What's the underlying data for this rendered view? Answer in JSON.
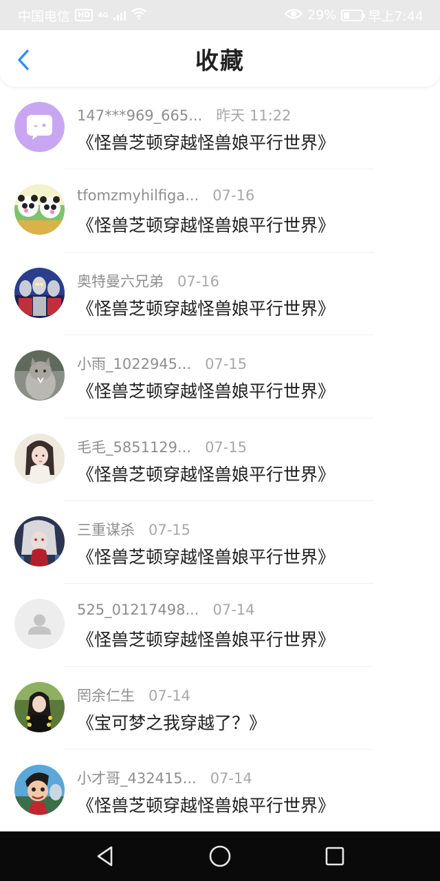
{
  "status_bar": {
    "carrier": "中国电信",
    "hd": "HD",
    "network": "4G",
    "battery": "29%",
    "time": "早上7:44"
  },
  "header": {
    "title": "收藏",
    "back_icon": "chevron-left-icon"
  },
  "favorites": [
    {
      "name": "147***969_665...",
      "time": "昨天 11:22",
      "book": "《怪兽芝顿穿越怪兽娘平行世界》",
      "avatar": "chat-bubble-avatar"
    },
    {
      "name": "tfomzmyhilfiga...",
      "time": "07-16",
      "book": "《怪兽芝顿穿越怪兽娘平行世界》",
      "avatar": "panda-avatar"
    },
    {
      "name": "奥特曼六兄弟",
      "time": "07-16",
      "book": "《怪兽芝顿穿越怪兽娘平行世界》",
      "avatar": "ultraman-avatar"
    },
    {
      "name": "小雨_1022945...",
      "time": "07-15",
      "book": "《怪兽芝顿穿越怪兽娘平行世界》",
      "avatar": "cat-avatar"
    },
    {
      "name": "毛毛_5851129...",
      "time": "07-15",
      "book": "《怪兽芝顿穿越怪兽娘平行世界》",
      "avatar": "anime-girl-avatar"
    },
    {
      "name": "三重谋杀",
      "time": "07-15",
      "book": "《怪兽芝顿穿越怪兽娘平行世界》",
      "avatar": "dark-anime-avatar"
    },
    {
      "name": "525_01217498...",
      "time": "07-14",
      "book": "《怪兽芝顿穿越怪兽娘平行世界》",
      "avatar": "default-user-avatar"
    },
    {
      "name": "罔余仁生",
      "time": "07-14",
      "book": "《宝可梦之我穿越了？》",
      "avatar": "girl-photo-avatar"
    },
    {
      "name": "小才哥_432415...",
      "time": "07-14",
      "book": "《怪兽芝顿穿越怪兽娘平行世界》",
      "avatar": "cartoon-boy-avatar"
    }
  ],
  "nav_bar": {
    "back": "triangle-back-icon",
    "home": "circle-home-icon",
    "recent": "square-recent-icon"
  },
  "colors": {
    "accent": "#2f8cf0",
    "status_bar_bg": "#e9e9e9",
    "nav_bar_bg": "#0a0a0a"
  }
}
